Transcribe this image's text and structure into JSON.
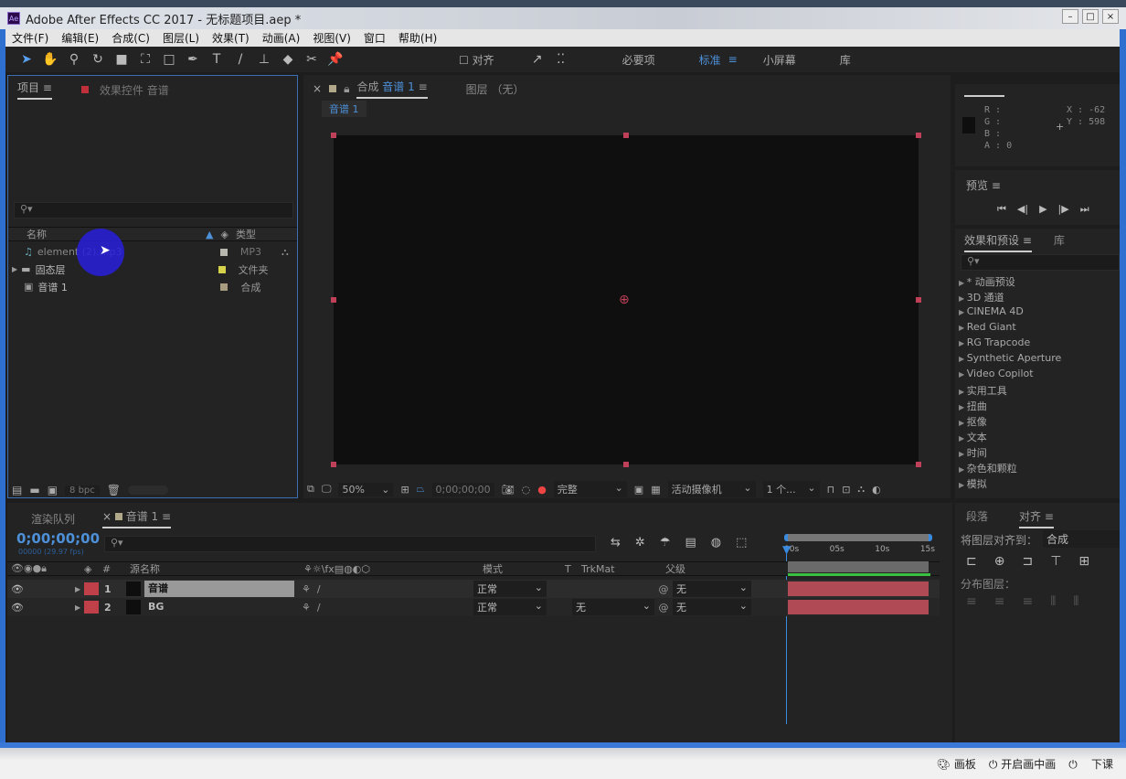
{
  "window": {
    "title": "Adobe After Effects CC 2017 - 无标题项目.aep *",
    "logo": "Ae"
  },
  "menu": [
    "文件(F)",
    "编辑(E)",
    "合成(C)",
    "图层(L)",
    "效果(T)",
    "动画(A)",
    "视图(V)",
    "窗口",
    "帮助(H)"
  ],
  "toolbar": {
    "align_label": "对齐",
    "workspaces": [
      "必要项",
      "标准",
      "小屏幕",
      "库"
    ],
    "active_workspace": "标准"
  },
  "project": {
    "tab": "项目",
    "effects_tab": "效果控件 音谱",
    "search_placeholder": "",
    "col_name": "名称",
    "col_type": "类型",
    "items": [
      {
        "name": "element (2).mp3",
        "type": "MP3",
        "color": "#b8b8b0"
      },
      {
        "name": "固态层",
        "type": "文件夹",
        "color": "#d6d24a"
      },
      {
        "name": "音谱 1",
        "type": "合成",
        "color": "#a89c80"
      }
    ],
    "bpc": "8 bpc"
  },
  "composition": {
    "tab_prefix": "合成",
    "tab_name": "音谱 1",
    "layer_tab": "图层 （无）",
    "breadcrumb": "音谱 1",
    "zoom": "50%",
    "timecode": "0;00;00;00",
    "resolution": "完整",
    "camera": "活动摄像机",
    "views": "1 个..."
  },
  "info": {
    "r": "R :",
    "g": "G :",
    "b": "B :",
    "a": "A : 0",
    "x": "X : -62",
    "y": "Y : 598"
  },
  "preview": {
    "title": "预览"
  },
  "effects": {
    "tab": "效果和预设",
    "library_tab": "库",
    "items": [
      "* 动画预设",
      "3D 通道",
      "CINEMA 4D",
      "Red Giant",
      "RG Trapcode",
      "Synthetic Aperture",
      "Video Copilot",
      "实用工具",
      "扭曲",
      "抠像",
      "文本",
      "时间",
      "杂色和颗粒",
      "模拟"
    ]
  },
  "timeline": {
    "render_tab": "渲染队列",
    "comp_tab": "音谱 1",
    "timecode": "0;00;00;00",
    "fps": "00000 (29.97 fps)",
    "col_num": "#",
    "col_source": "源名称",
    "col_mode": "模式",
    "col_t": "T",
    "col_trkmat": "TrkMat",
    "col_parent": "父级",
    "ruler": [
      "00s",
      "05s",
      "10s",
      "15s"
    ],
    "layers": [
      {
        "num": "1",
        "name": "音谱",
        "mode": "正常",
        "trkmat": "",
        "parent": "无",
        "color": "#c0404a"
      },
      {
        "num": "2",
        "name": "BG",
        "mode": "正常",
        "trkmat": "无",
        "parent": "无",
        "color": "#c0404a"
      }
    ]
  },
  "align": {
    "tab1": "段落",
    "tab2": "对齐",
    "align_to_label": "将图层对齐到：",
    "align_to": "合成",
    "distribute_label": "分布图层："
  },
  "taskbar": {
    "board": "画板",
    "pip": "开启画中画",
    "end": "下课"
  }
}
